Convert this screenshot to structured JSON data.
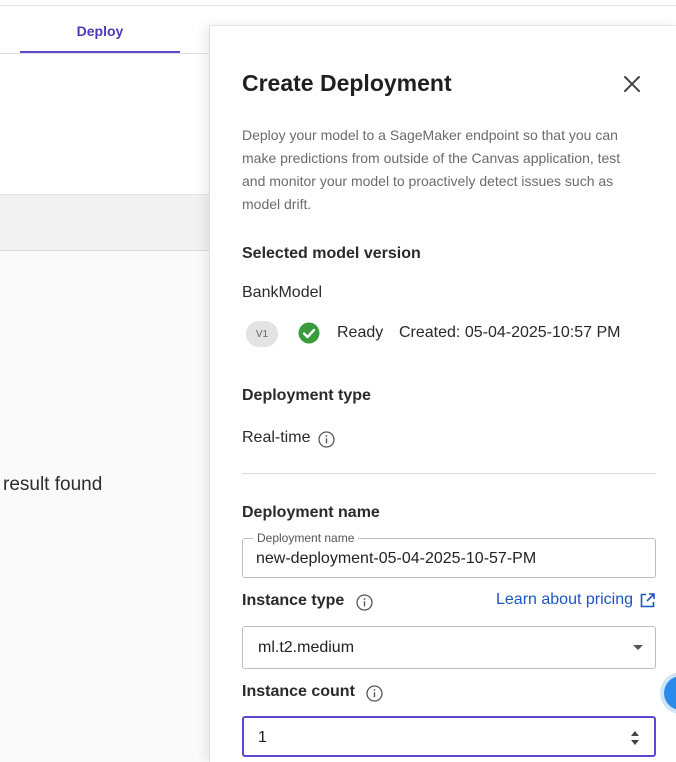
{
  "background": {
    "tab_label": "Deploy",
    "empty_state_text": "result found"
  },
  "drawer": {
    "title": "Create Deployment",
    "description": "Deploy your model to a SageMaker endpoint so that you can make predictions from outside of the Canvas application, test and monitor your model to proactively detect issues such as model drift.",
    "selected_version_label": "Selected model version",
    "model_name": "BankModel",
    "version_badge": "V1",
    "status_text": "Ready",
    "created_text": "Created: 05-04-2025-10:57 PM",
    "deployment_type_label": "Deployment type",
    "deployment_type_value": "Real-time",
    "deployment_name_label": "Deployment name",
    "deployment_name_field_legend": "Deployment name",
    "deployment_name_value": "new-deployment-05-04-2025-10-57-PM",
    "instance_type_label": "Instance type",
    "pricing_link": "Learn about pricing",
    "instance_type_value": "ml.t2.medium",
    "instance_count_label": "Instance count",
    "instance_count_value": "1"
  },
  "colors": {
    "accent": "#5b4ad1",
    "link": "#1a56c8",
    "ready_green": "#3a9b3d"
  },
  "icons": [
    "close-icon",
    "check-circle-icon",
    "info-icon",
    "external-link-icon",
    "chevron-down-icon",
    "stepper-icon",
    "help-icon"
  ]
}
